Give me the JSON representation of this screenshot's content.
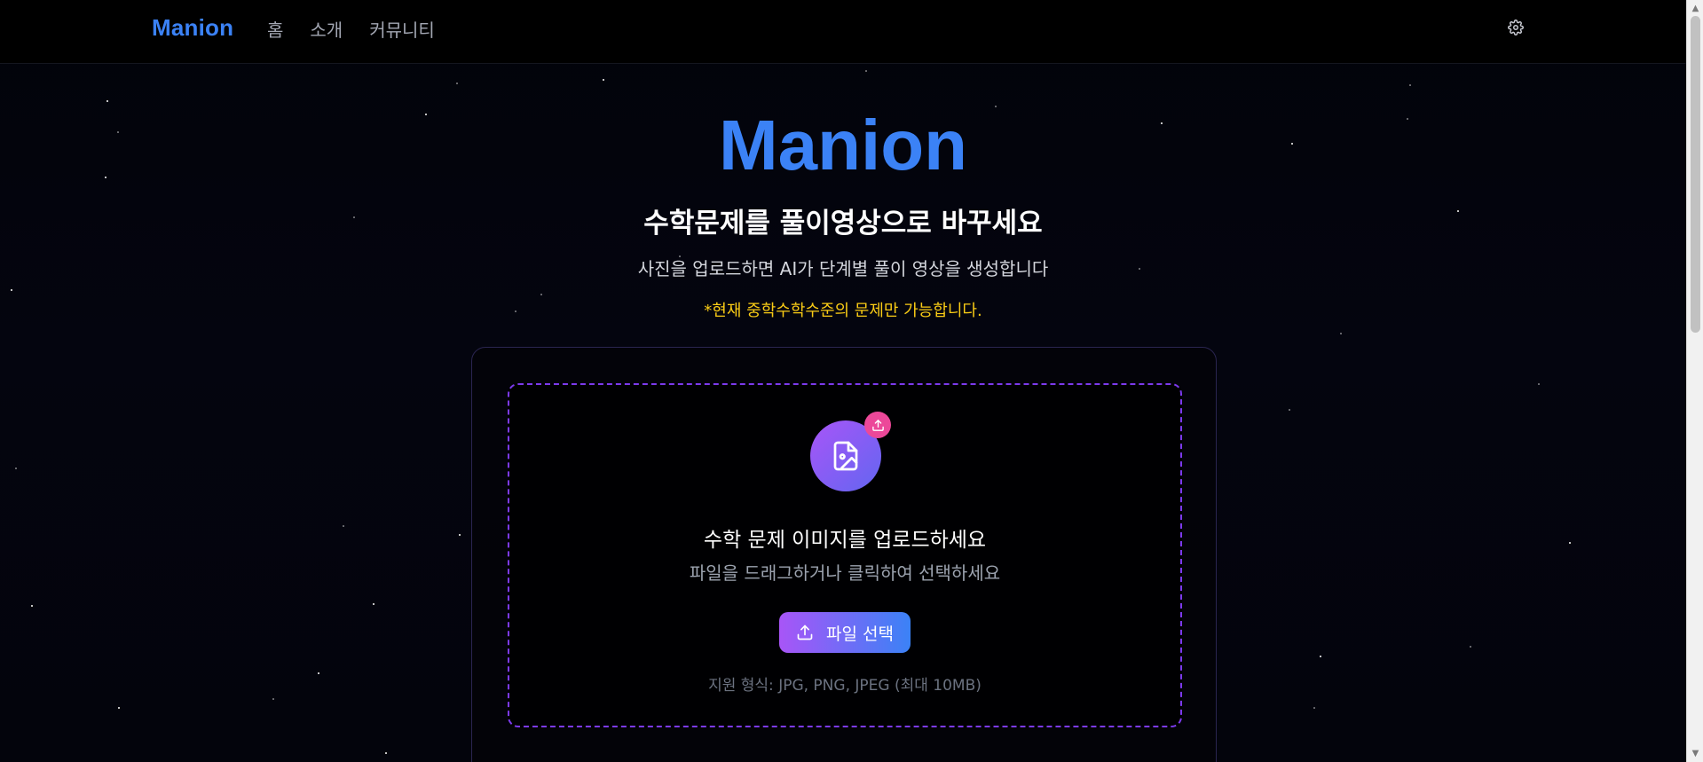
{
  "header": {
    "brand": "Manion",
    "nav": [
      "홈",
      "소개",
      "커뮤니티"
    ],
    "settings_icon": "gear-icon"
  },
  "hero": {
    "title": "Manion",
    "subtitle": "수학문제를 풀이영상으로 바꾸세요",
    "description": "사진을 업로드하면 AI가 단계별 풀이 영상을 생성합니다",
    "note": "*현재 중학수학수준의 문제만 가능합니다."
  },
  "upload": {
    "icon": "file-image-icon",
    "badge_icon": "upload-icon",
    "title": "수학 문제 이미지를 업로드하세요",
    "subtitle": "파일을 드래그하거나 클릭하여 선택하세요",
    "button_label": "파일 선택",
    "button_icon": "upload-icon",
    "formats": "지원 형식: JPG, PNG, JPEG (최대 10MB)"
  },
  "colors": {
    "brand": "#3b82f6",
    "note": "#facc15",
    "accent_purple": "#a855f7",
    "badge_pink": "#ec4899",
    "dashed_border": "#7c3aed"
  }
}
